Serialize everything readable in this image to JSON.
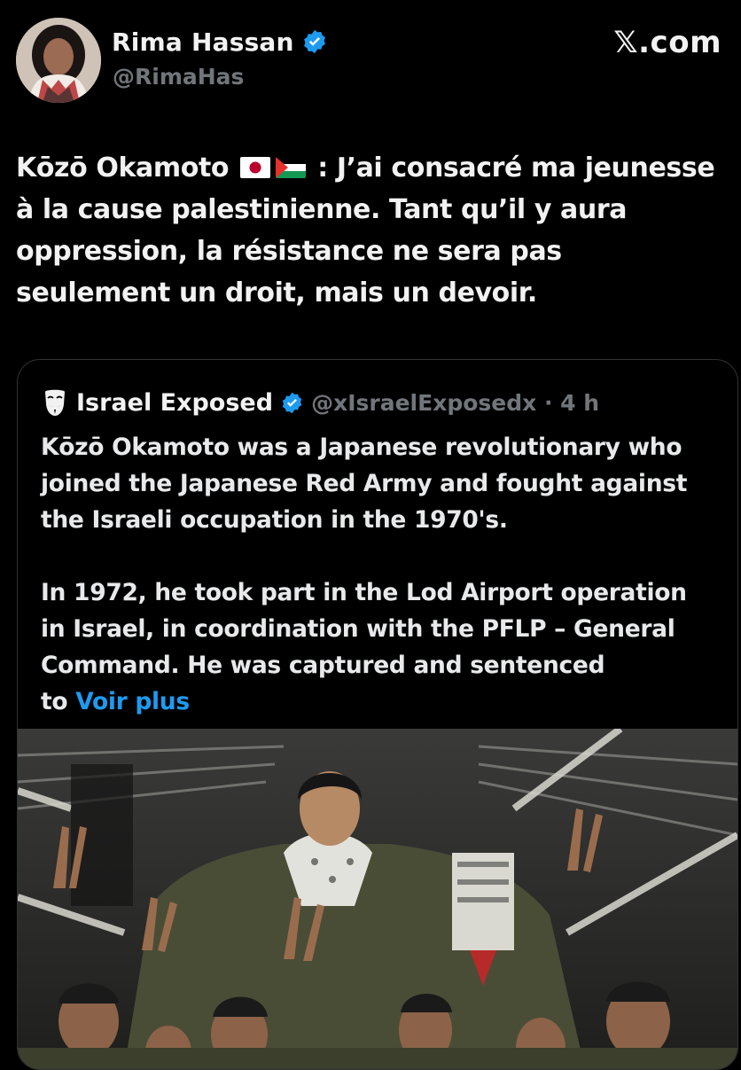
{
  "author": {
    "display_name": "Rima Hassan",
    "handle": "@RimaHas",
    "verified": true
  },
  "brand": "𝕏.com",
  "post": {
    "lines": [
      "Kōzō Okamoto",
      ": J’ai consacré ma jeunesse",
      "à la cause palestinienne. Tant qu’il y aura",
      "oppression, la résistance ne sera pas",
      "seulement un droit, mais un devoir."
    ],
    "flags": [
      "japan-flag",
      "palestine-flag"
    ]
  },
  "quoted_post": {
    "author_name": "Israel Exposed",
    "author_icon": "guy-fawkes-mask-icon",
    "handle_time": "@xIsraelExposedx · 4 h",
    "paragraph_1": [
      "Kōzō Okamoto was a Japanese revolutionary who",
      "joined the Japanese Red Army and fought against",
      "the Israeli occupation in the 1970's."
    ],
    "paragraph_2": [
      "In 1972, he took part in the Lod Airport operation",
      "in Israel, in coordination with the PFLP – General",
      "Command. He was captured and sentenced"
    ],
    "last_line_prefix": "to ",
    "more_link": "Voir plus",
    "photo_alt": "Archival photo of a man carried on shoulders of a crowd showing victory signs"
  },
  "colors": {
    "background": "#000000",
    "text": "#e7e9ea",
    "muted": "#71767b",
    "link": "#1d9bf0",
    "verified": "#1d9bf0",
    "border": "#2f3336"
  }
}
